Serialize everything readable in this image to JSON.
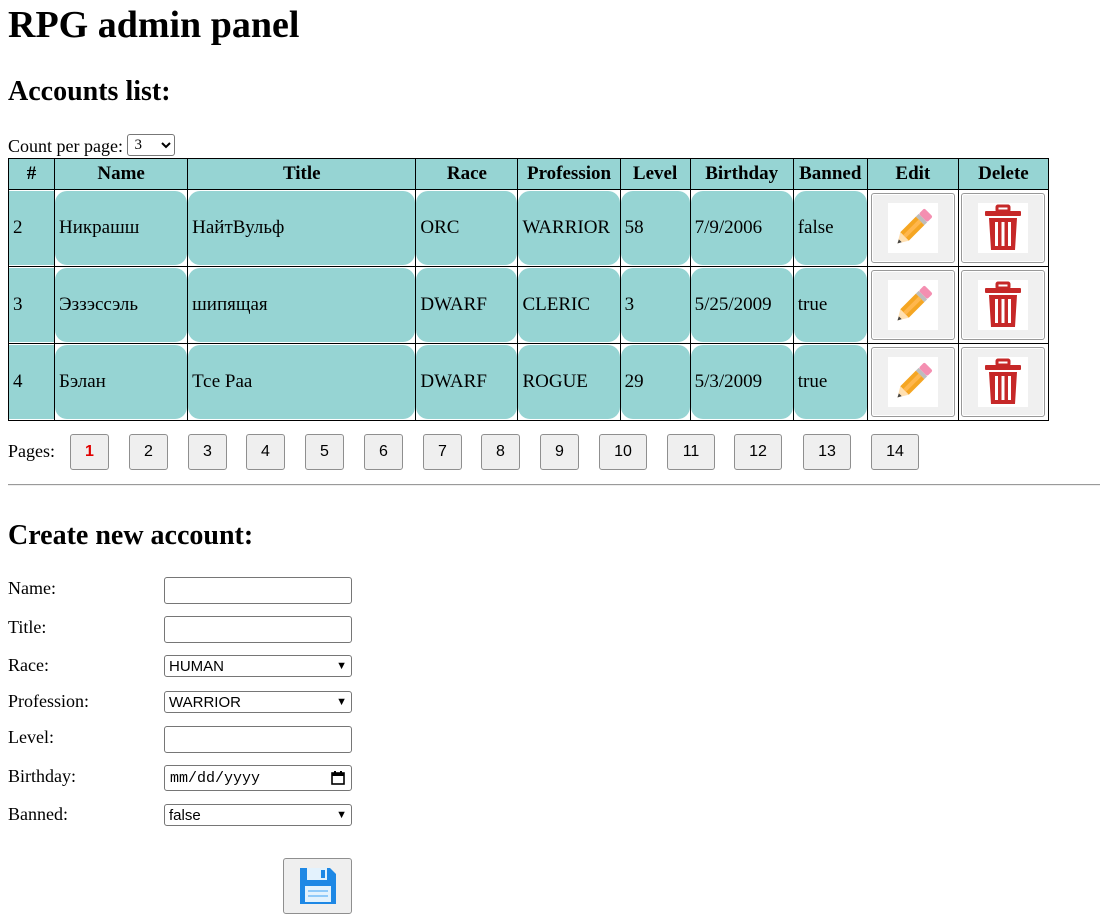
{
  "page_title": "RPG admin panel",
  "accounts_heading": "Accounts list:",
  "count_per_page": {
    "label": "Count per page:",
    "value": "3"
  },
  "table": {
    "headers": [
      "#",
      "Name",
      "Title",
      "Race",
      "Profession",
      "Level",
      "Birthday",
      "Banned",
      "Edit",
      "Delete"
    ],
    "rows": [
      {
        "id": "2",
        "name": "Никрашш",
        "title": "НайтВульф",
        "race": "ORC",
        "profession": "WARRIOR",
        "level": "58",
        "birthday": "7/9/2006",
        "banned": "false"
      },
      {
        "id": "3",
        "name": "Эззэссэль",
        "title": "шипящая",
        "race": "DWARF",
        "profession": "CLERIC",
        "level": "3",
        "birthday": "5/25/2009",
        "banned": "true"
      },
      {
        "id": "4",
        "name": "Бэлан",
        "title": "Тсе Раа",
        "race": "DWARF",
        "profession": "ROGUE",
        "level": "29",
        "birthday": "5/3/2009",
        "banned": "true"
      }
    ]
  },
  "pagination": {
    "label": "Pages:",
    "pages": [
      "1",
      "2",
      "3",
      "4",
      "5",
      "6",
      "7",
      "8",
      "9",
      "10",
      "11",
      "12",
      "13",
      "14"
    ],
    "current": "1"
  },
  "create_heading": "Create new account:",
  "form": {
    "name_label": "Name:",
    "title_label": "Title:",
    "race_label": "Race:",
    "race_value": "HUMAN",
    "profession_label": "Profession:",
    "profession_value": "WARRIOR",
    "level_label": "Level:",
    "birthday_label": "Birthday:",
    "birthday_placeholder": "mm/dd/yyyy",
    "banned_label": "Banned:",
    "banned_value": "false"
  },
  "colors": {
    "cell_bg": "#96d4d3",
    "current_page": "#e10000",
    "trash_red": "#c62828",
    "pencil_orange": "#f5a623",
    "save_blue": "#1e88e5"
  },
  "icons": {
    "edit": "pencil-icon",
    "delete": "trash-icon",
    "save": "floppy-disk-icon",
    "calendar": "calendar-icon",
    "dropdown": "chevron-down-icon"
  }
}
